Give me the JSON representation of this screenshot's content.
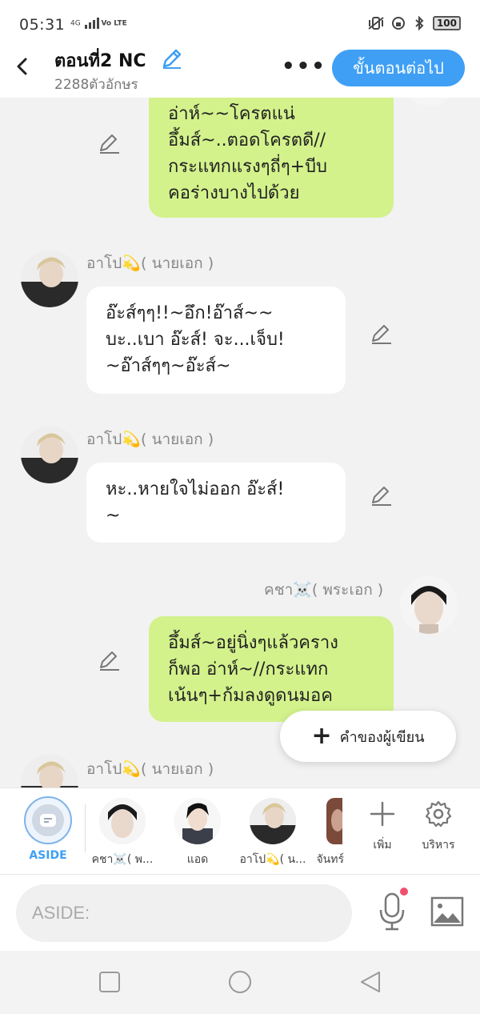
{
  "status": {
    "time": "05:31",
    "network": "4G",
    "volte": "Vo LTE",
    "battery": "100"
  },
  "header": {
    "title": "ตอนที่2 NC",
    "char_count": "2288ตัวอักษร",
    "more_label": "•••",
    "next_label": "ขั้นตอนต่อไป"
  },
  "messages": [
    {
      "lines": [
        "อ่าห์~~โครตแน่",
        "อึ้มส์~..ตอดโครตดี//",
        "กระแทกแรงๆถี่ๆ+บีบ",
        "คอร่างบางไปด้วย"
      ]
    },
    {
      "name": "อาโป💫( นายเอก )",
      "lines": [
        "อ๊ะส์ๆๆ!!~อึก!อ๊าส์~~",
        "บะ..เบา อ๊ะส์! จะ...เจ็บ!",
        "~อ๊าส์ๆๆ~อ๊ะส์~"
      ]
    },
    {
      "name": "อาโป💫( นายเอก )",
      "lines": [
        "หะ..หายใจไม่ออก อ๊ะส์!",
        "~"
      ]
    },
    {
      "name": "คชา☠️( พระเอก )",
      "lines": [
        "อึ้มส์~อยู่นิ่งๆแล้วคราง",
        "ก็พอ อ่าห์~//กระแทก",
        "เน้นๆ+ก้มลงดูดนมอค"
      ]
    },
    {
      "name": "อาโป💫( นายเอก )"
    }
  ],
  "floating_button": {
    "label": "คำของผู้เขียน"
  },
  "character_bar": {
    "aside_label": "ASIDE",
    "characters": [
      "คชา☠️( พ...",
      "แอด",
      "อาโป💫( น...",
      "จันทร์"
    ],
    "add_label": "เพิ่ม",
    "manage_label": "บริหาร"
  },
  "input": {
    "placeholder": "ASIDE:"
  },
  "colors": {
    "accent": "#3f9ff5",
    "bubble_green": "#d3f28c",
    "background": "#f2f2f2"
  }
}
